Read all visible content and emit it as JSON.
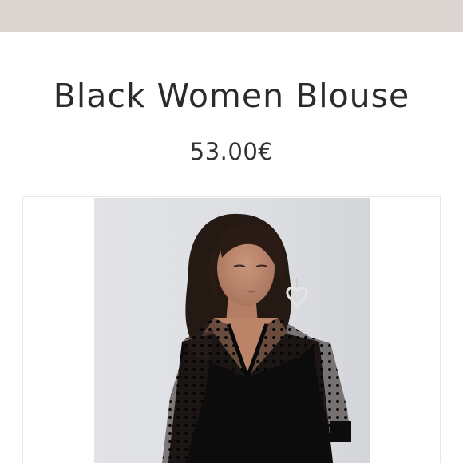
{
  "product": {
    "title": "Black Women Blouse",
    "price": "53.00€"
  },
  "image": {
    "subject": "woman-in-black-blouse-photo"
  },
  "colors": {
    "top_bar": "#dcd5d1",
    "text": "#2b2b2b",
    "frame_border": "#e9e6e4",
    "photo_background": "#dfe1e5",
    "blouse": "#0c0c0c"
  }
}
